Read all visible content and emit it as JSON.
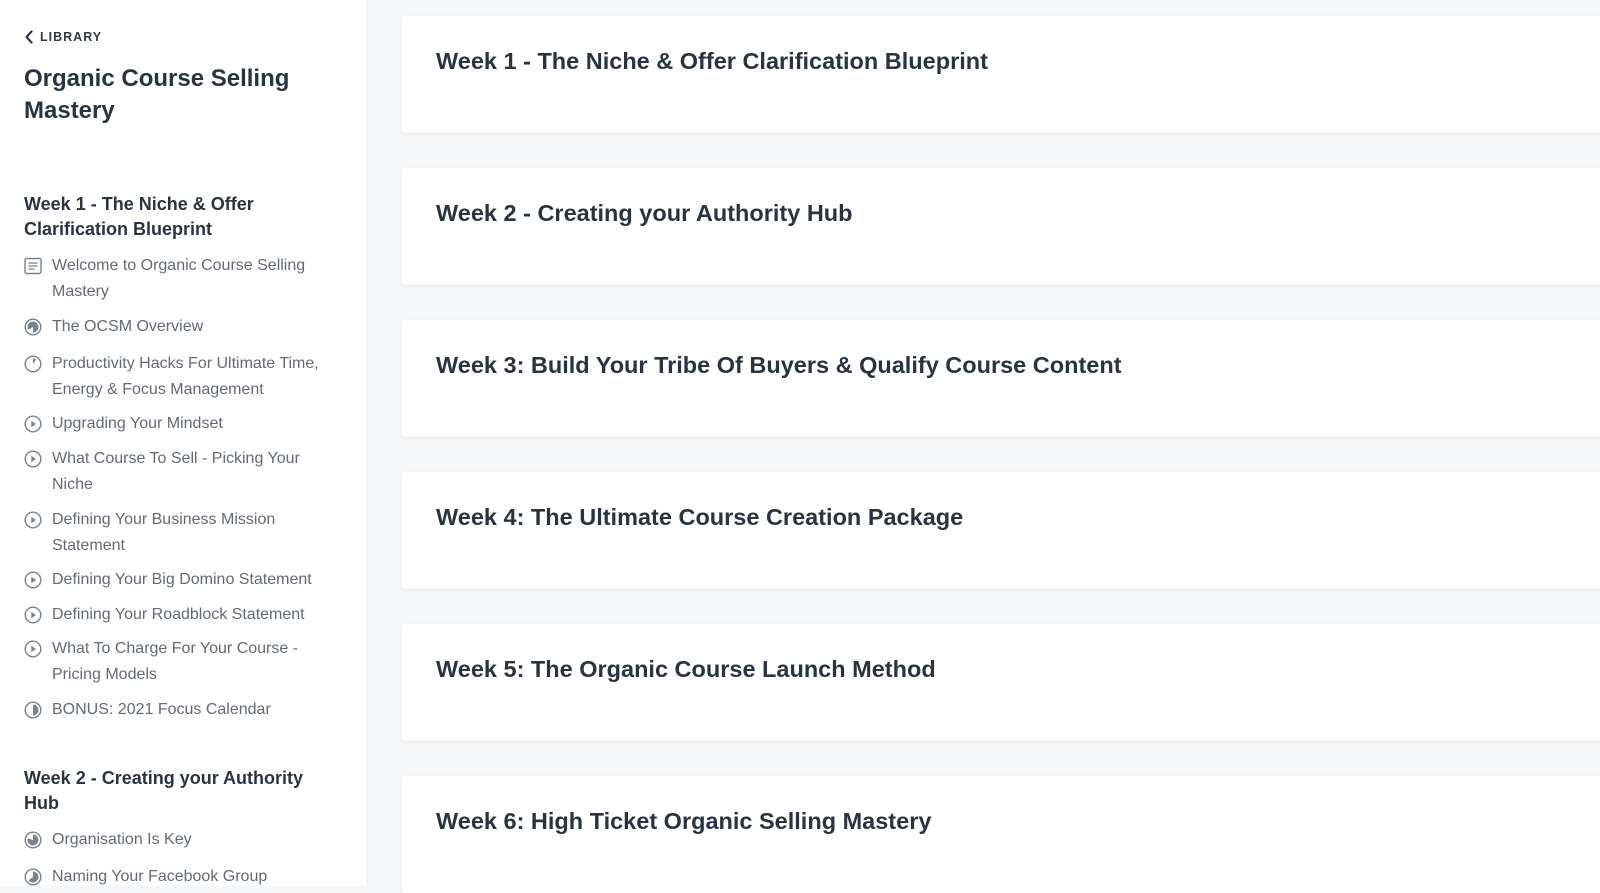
{
  "sidebar": {
    "back_label": "LIBRARY",
    "course_title": "Organic Course Selling Mastery",
    "sections": [
      {
        "title": "Week 1 - The Niche & Offer Clarification Blueprint",
        "lessons": [
          {
            "icon": "text-doc-icon",
            "label": "Welcome to Organic Course Selling Mastery"
          },
          {
            "icon": "progress-half-icon",
            "label": "The OCSM Overview"
          },
          {
            "icon": "progress-low-icon",
            "label": "Productivity Hacks For Ultimate Time, Energy & Focus Management"
          },
          {
            "icon": "play-circle-icon",
            "label": "Upgrading Your Mindset"
          },
          {
            "icon": "play-circle-icon",
            "label": "What Course To Sell - Picking Your Niche"
          },
          {
            "icon": "play-circle-icon",
            "label": "Defining Your Business Mission Statement"
          },
          {
            "icon": "play-circle-icon",
            "label": "Defining Your Big Domino Statement"
          },
          {
            "icon": "play-circle-icon",
            "label": "Defining Your Roadblock Statement"
          },
          {
            "icon": "play-circle-icon",
            "label": "What To Charge For Your Course - Pricing Models"
          },
          {
            "icon": "progress-half-icon",
            "label": "BONUS: 2021 Focus Calendar"
          }
        ]
      },
      {
        "title": "Week 2 - Creating your Authority Hub",
        "lessons": [
          {
            "icon": "progress-high-icon",
            "label": "Organisation Is Key"
          },
          {
            "icon": "progress-half-icon",
            "label": "Naming Your Facebook Group"
          }
        ]
      }
    ]
  },
  "main": {
    "modules": [
      {
        "title": "Week 1 - The Niche & Offer Clarification Blueprint"
      },
      {
        "title": "Week 2 - Creating your Authority Hub"
      },
      {
        "title": "Week 3: Build Your Tribe Of Buyers & Qualify Course Content"
      },
      {
        "title": "Week 4: The Ultimate Course Creation Package"
      },
      {
        "title": "Week 5: The Organic Course Launch Method"
      },
      {
        "title": "Week 6: High Ticket Organic Selling Mastery"
      }
    ]
  },
  "colors": {
    "background": "#f6f7f8",
    "card": "#ffffff",
    "heading": "#2b3340",
    "muted_text": "#646a72",
    "icon": "#7b828b"
  }
}
